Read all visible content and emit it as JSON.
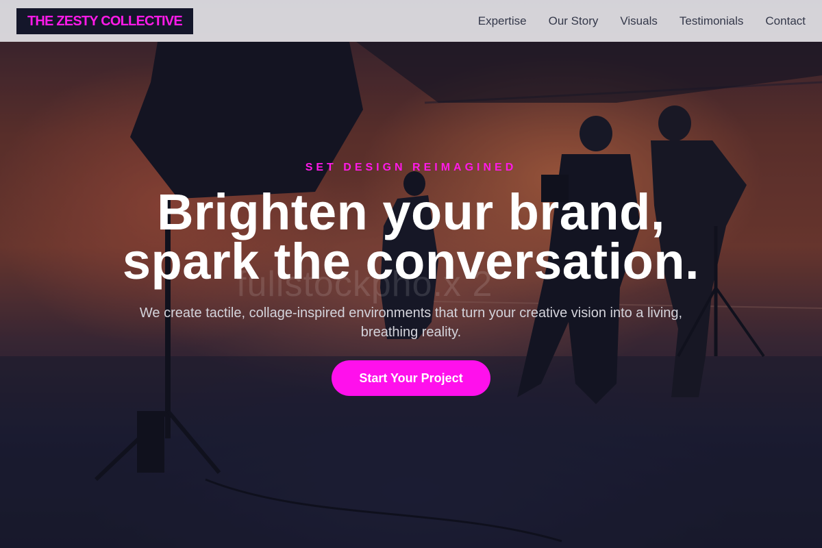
{
  "brand": {
    "name": "THE ZESTY COLLECTIVE",
    "accent": "#ff1ae8"
  },
  "nav": {
    "items": [
      {
        "label": "Expertise"
      },
      {
        "label": "Our Story"
      },
      {
        "label": "Visuals"
      },
      {
        "label": "Testimonials"
      },
      {
        "label": "Contact"
      }
    ]
  },
  "hero": {
    "eyebrow": "SET DESIGN REIMAGINED",
    "headline_line1": "Brighten your brand,",
    "headline_line2": "spark the conversation.",
    "subtext": "We create tactile, collage-inspired environments that turn your creative vision into a living, breathing reality.",
    "cta_label": "Start Your Project",
    "watermark": "fullstockpho.x 2"
  },
  "colors": {
    "nav_bg": "#ececf0",
    "logo_bg": "#14162a",
    "cta_bg": "#ff10ec",
    "headline": "#ffffff"
  }
}
